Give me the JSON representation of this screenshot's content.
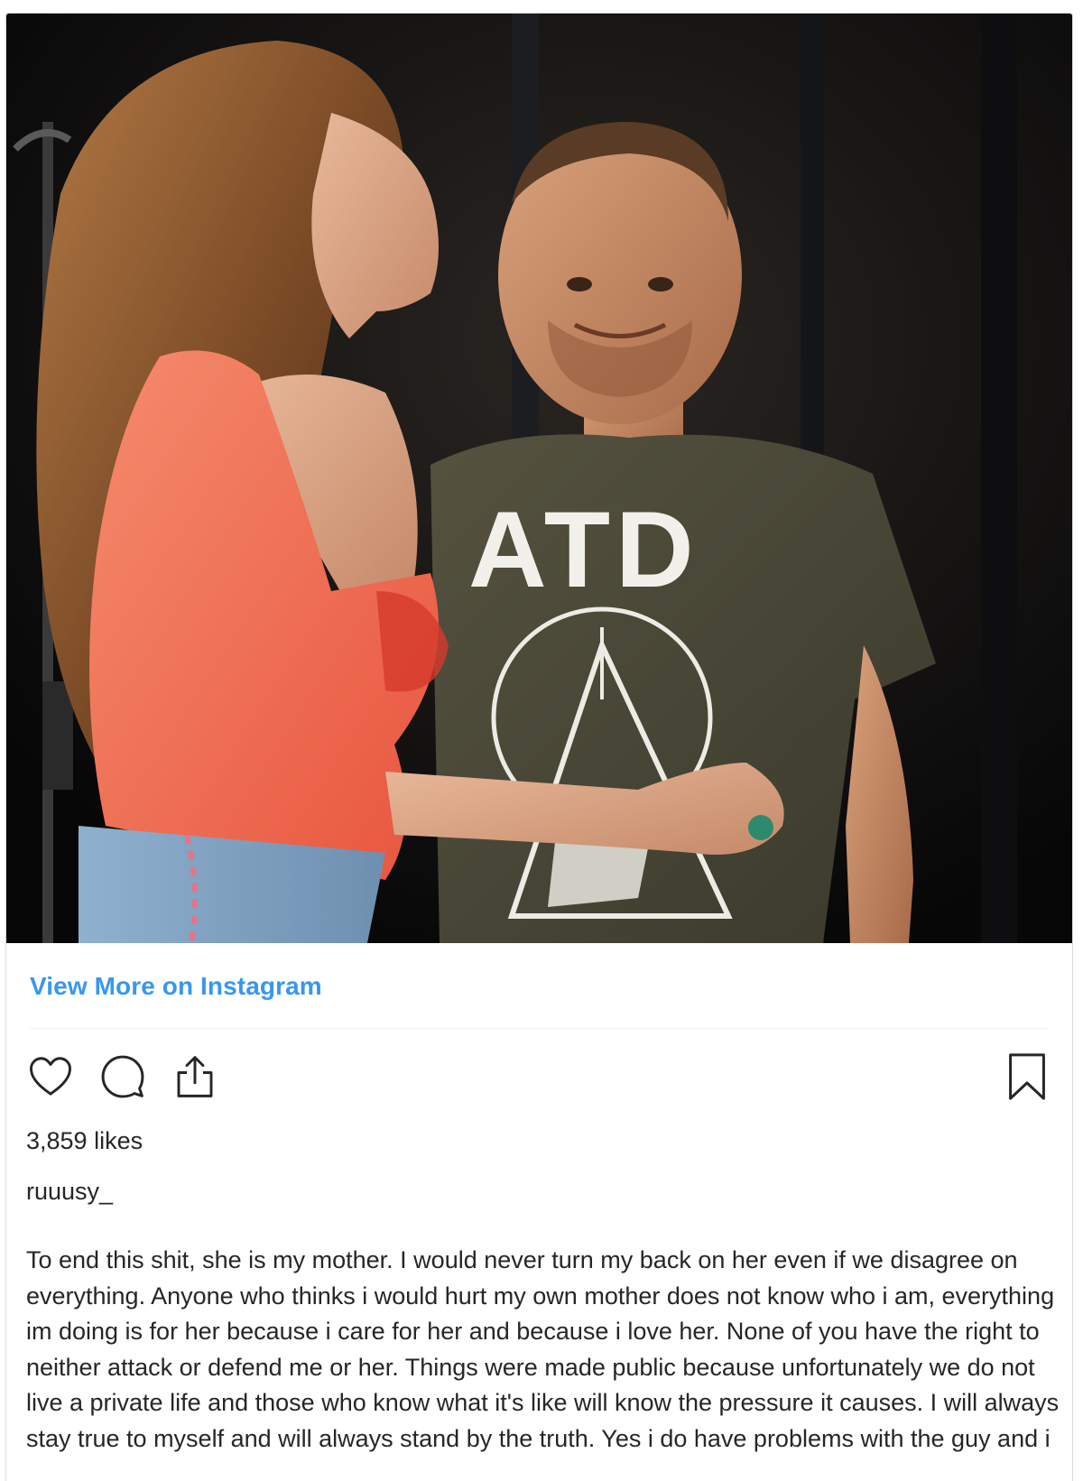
{
  "post": {
    "image_alt": "Woman in a coral top and a smiling man in an olive T-shirt printed ATD on stage",
    "shirt_print": "ATD",
    "view_more_label": "View More on Instagram",
    "likes": "3,859 likes",
    "username": "ruuusy_",
    "caption": "To end this shit, she is my mother. I would never turn my back on her even if we disagree on everything. Anyone who thinks i would hurt my own mother does not know who i am, everything im doing is for her because i care for her and because i love her. None of you have the right to neither attack or defend me or her. Things were made public because unfortunately we do not live a private life and those who know what it's like will know the pressure it causes. I will always stay true to myself and will always stand by the truth. Yes i do have problems with the guy and i"
  },
  "icons": {
    "like": "heart-outline",
    "comment": "speech-bubble-outline",
    "share": "upload-arrow",
    "save": "bookmark-outline"
  },
  "colors": {
    "link": "#3897f0",
    "text": "#262626",
    "divider": "#efefef"
  }
}
